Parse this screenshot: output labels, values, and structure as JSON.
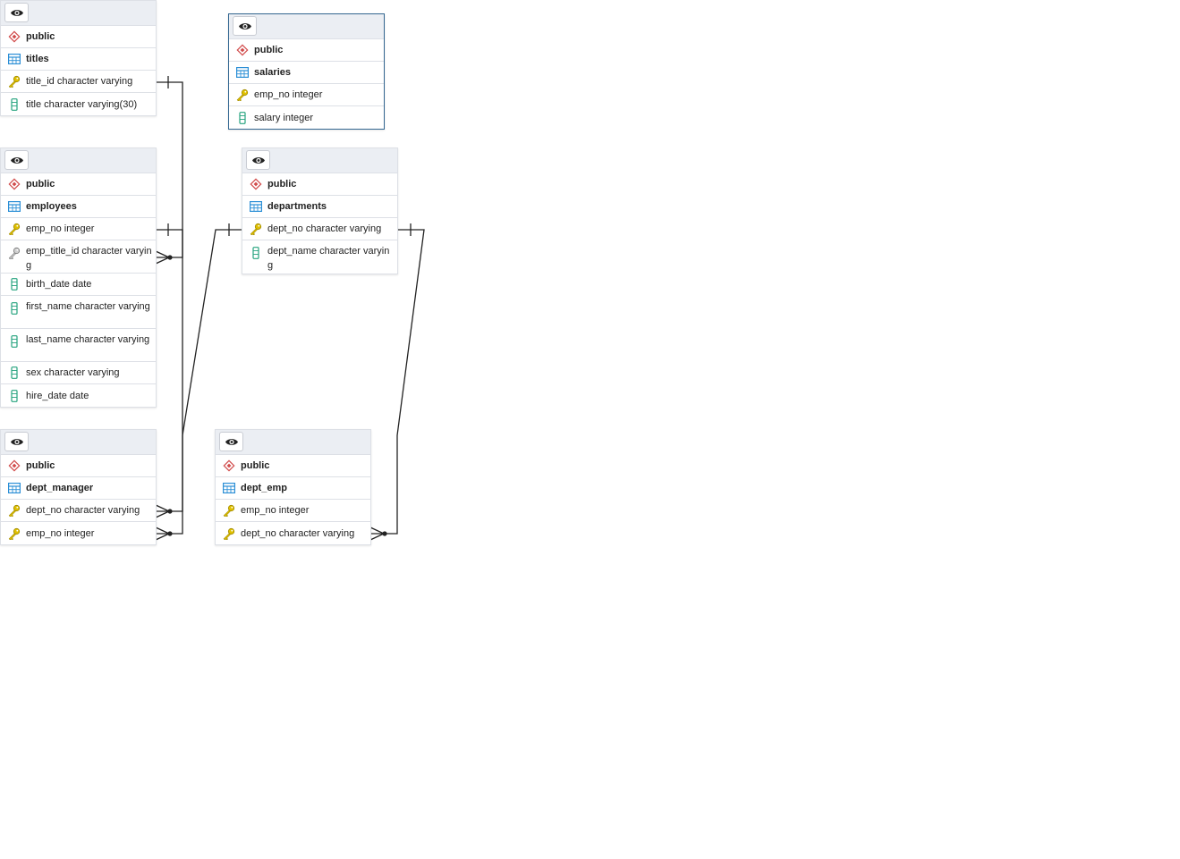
{
  "tables": {
    "titles": {
      "schema": "public",
      "name": "titles",
      "columns": [
        {
          "text": "title_id character varying",
          "kind": "pk"
        },
        {
          "text": "title character varying(30)",
          "kind": "col"
        }
      ]
    },
    "salaries": {
      "schema": "public",
      "name": "salaries",
      "columns": [
        {
          "text": "emp_no integer",
          "kind": "pk"
        },
        {
          "text": "salary integer",
          "kind": "col"
        }
      ]
    },
    "employees": {
      "schema": "public",
      "name": "employees",
      "columns": [
        {
          "text": "emp_no integer",
          "kind": "pk"
        },
        {
          "text": "emp_title_id character varying",
          "kind": "fk"
        },
        {
          "text": "birth_date date",
          "kind": "col"
        },
        {
          "text": "first_name character varying",
          "kind": "col"
        },
        {
          "text": "last_name character varying",
          "kind": "col"
        },
        {
          "text": "sex character varying",
          "kind": "col"
        },
        {
          "text": "hire_date date",
          "kind": "col"
        }
      ]
    },
    "departments": {
      "schema": "public",
      "name": "departments",
      "columns": [
        {
          "text": "dept_no character varying",
          "kind": "pk"
        },
        {
          "text": "dept_name character varying",
          "kind": "col"
        }
      ]
    },
    "dept_manager": {
      "schema": "public",
      "name": "dept_manager",
      "columns": [
        {
          "text": "dept_no character varying",
          "kind": "pk"
        },
        {
          "text": "emp_no integer",
          "kind": "pk"
        }
      ]
    },
    "dept_emp": {
      "schema": "public",
      "name": "dept_emp",
      "columns": [
        {
          "text": "emp_no integer",
          "kind": "pk"
        },
        {
          "text": "dept_no character varying",
          "kind": "pk"
        }
      ]
    }
  },
  "icons": {
    "view": "eye-icon",
    "schema": "schema-diamond-icon",
    "table": "table-grid-icon",
    "primary_key": "key-icon",
    "foreign_key": "foreign-key-icon",
    "column": "column-icon"
  },
  "colors": {
    "header_bg": "#ebeef3",
    "border": "#dde0e6",
    "selected_border": "#326690",
    "key": "#e0c000",
    "schema": "#d14b4b",
    "table_icon": "#2b8fd6",
    "column_icon": "#26a37e",
    "link": "#222222"
  }
}
